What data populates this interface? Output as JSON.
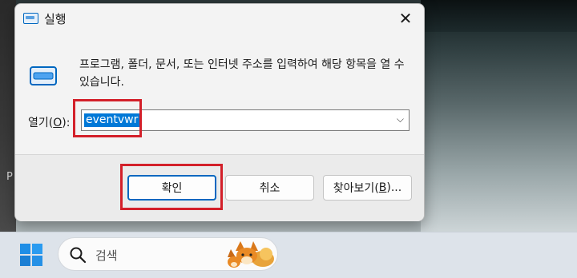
{
  "dialog": {
    "title": "실행",
    "description": "프로그램, 폴더, 문서, 또는 인터넷 주소를 입력하여 해당 항목을 열 수 있습니다.",
    "open_label_prefix": "열기(",
    "open_label_accesskey": "O",
    "open_label_suffix": "):",
    "input_value": "eventvwr",
    "ok_label": "확인",
    "cancel_label": "취소",
    "browse_label_prefix": "찾아보기(",
    "browse_label_accesskey": "B",
    "browse_label_suffix": ")..."
  },
  "background": {
    "left_letter": "P"
  },
  "taskbar": {
    "search_placeholder": "검색"
  },
  "colors": {
    "accent": "#0067c0",
    "selection": "#0078d7",
    "highlight_box": "#d3202a"
  },
  "icons": [
    "run-app-icon",
    "close-icon",
    "chevron-down-icon",
    "windows-start-icon",
    "search-icon",
    "fox-search-highlight-icon"
  ]
}
